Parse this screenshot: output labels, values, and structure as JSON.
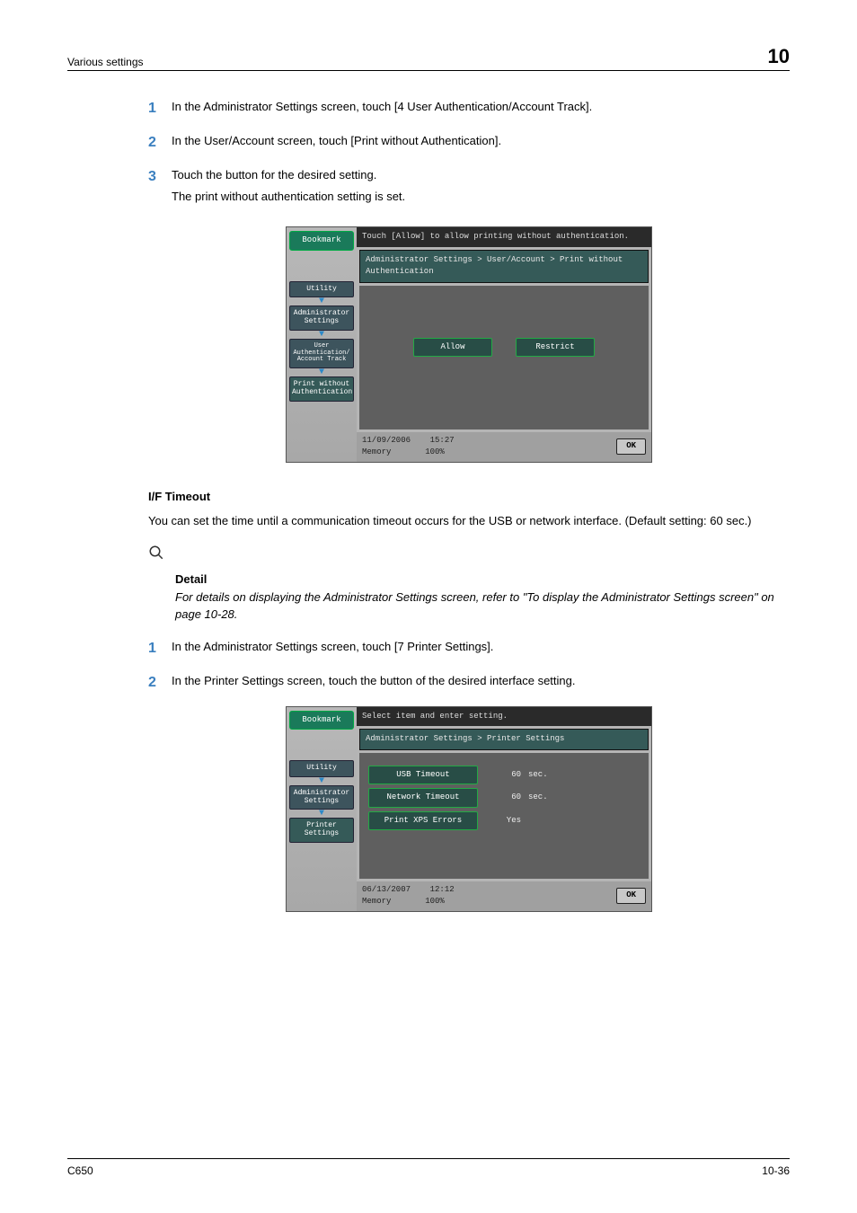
{
  "header": {
    "left": "Various settings",
    "right": "10"
  },
  "stepsA": [
    {
      "n": "1",
      "text": "In the Administrator Settings screen, touch [4 User Authentication/Account Track]."
    },
    {
      "n": "2",
      "text": "In the User/Account screen, touch [Print without Authentication]."
    },
    {
      "n": "3",
      "text": "Touch the button for the desired setting.",
      "sub": "The print without authentication setting is set."
    }
  ],
  "panel1": {
    "instr": "Touch [Allow] to allow printing without authentication.",
    "crumb": "Administrator Settings > User/Account > Print without Authentication",
    "bookmark": "Bookmark",
    "nav": [
      "Utility",
      "Administrator\nSettings",
      "User\nAuthentication/\nAccount Track",
      "Print without\nAuthentication"
    ],
    "allow": "Allow",
    "restrict": "Restrict",
    "date": "11/09/2006",
    "time": "15:27",
    "memory": "Memory",
    "mempct": "100%",
    "ok": "OK"
  },
  "section_if": {
    "title": "I/F Timeout",
    "body": "You can set the time until a communication timeout occurs for the USB or network interface. (Default setting: 60 sec.)",
    "detail_label": "Detail",
    "detail_text": "For details on displaying the Administrator Settings screen, refer to \"To display the Administrator Settings screen\" on page 10-28."
  },
  "stepsB": [
    {
      "n": "1",
      "text": "In the Administrator Settings screen, touch [7 Printer Settings]."
    },
    {
      "n": "2",
      "text": "In the Printer Settings screen, touch the button of the desired interface setting."
    }
  ],
  "panel2": {
    "instr": "Select item and enter setting.",
    "crumb": "Administrator Settings > Printer Settings",
    "bookmark": "Bookmark",
    "nav": [
      "Utility",
      "Administrator\nSettings",
      "Printer Settings"
    ],
    "rows": [
      {
        "label": "USB Timeout",
        "val": "60",
        "unit": "sec."
      },
      {
        "label": "Network Timeout",
        "val": "60",
        "unit": "sec."
      },
      {
        "label": "Print XPS Errors",
        "val": "Yes",
        "unit": ""
      }
    ],
    "date": "06/13/2007",
    "time": "12:12",
    "memory": "Memory",
    "mempct": "100%",
    "ok": "OK"
  },
  "footer": {
    "left": "C650",
    "right": "10-36"
  }
}
